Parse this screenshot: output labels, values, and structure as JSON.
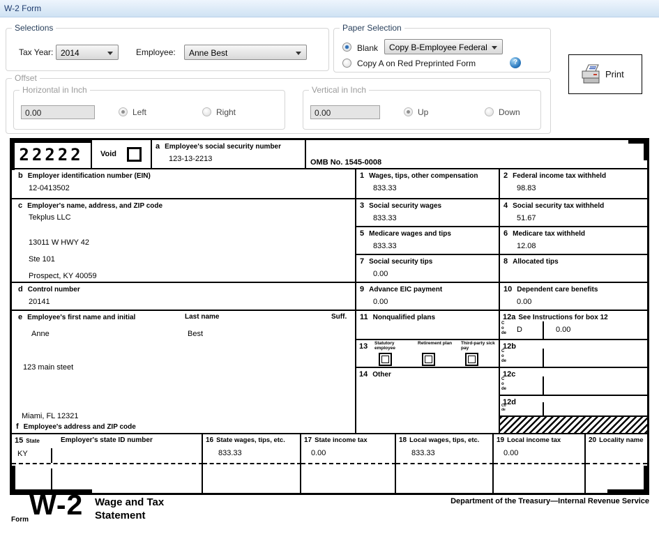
{
  "window": {
    "title": "W-2 Form"
  },
  "selections": {
    "label": "Selections",
    "tax_year": {
      "label": "Tax Year:",
      "value": "2014"
    },
    "employee": {
      "label": "Employee:",
      "value": "Anne Best"
    }
  },
  "paper_selection": {
    "label": "Paper Selection",
    "blank": "Blank",
    "copy_type": "Copy B-Employee Federal",
    "copy_a": "Copy A on Red Preprinted Form"
  },
  "print": {
    "label": "Print"
  },
  "offset": {
    "label": "Offset",
    "horizontal": {
      "label": "Horizontal in Inch",
      "value": "0.00",
      "left": "Left",
      "right": "Right"
    },
    "vertical": {
      "label": "Vertical in Inch",
      "value": "0.00",
      "up": "Up",
      "down": "Down"
    }
  },
  "form": {
    "code": "22222",
    "void": "Void",
    "omb": "OMB No. 1545-0008",
    "a": {
      "letter": "a",
      "label": "Employee's social security number",
      "value": "123-13-2213"
    },
    "b": {
      "letter": "b",
      "label": "Employer identification number (EIN)",
      "value": "12-0413502"
    },
    "c": {
      "letter": "c",
      "label": "Employer's name, address, and ZIP code",
      "line1": "Tekplus LLC",
      "line2": "13011 W HWY 42",
      "line3": "Ste 101",
      "line4": "Prospect, KY 40059"
    },
    "d": {
      "letter": "d",
      "label": "Control number",
      "value": "20141"
    },
    "e": {
      "letter": "e",
      "label": "Employee's first name and initial",
      "last_label": "Last name",
      "suff_label": "Suff.",
      "first": "Anne",
      "last": "Best",
      "street": "123 main steet",
      "city": "Miami, FL 12321"
    },
    "f": {
      "letter": "f",
      "label": "Employee's address and ZIP code"
    },
    "box1": {
      "num": "1",
      "label": "Wages, tips, other compensation",
      "value": "833.33"
    },
    "box2": {
      "num": "2",
      "label": "Federal income tax withheld",
      "value": "98.83"
    },
    "box3": {
      "num": "3",
      "label": "Social security wages",
      "value": "833.33"
    },
    "box4": {
      "num": "4",
      "label": "Social security tax withheld",
      "value": "51.67"
    },
    "box5": {
      "num": "5",
      "label": "Medicare wages and tips",
      "value": "833.33"
    },
    "box6": {
      "num": "6",
      "label": "Medicare tax withheld",
      "value": "12.08"
    },
    "box7": {
      "num": "7",
      "label": "Social security tips",
      "value": "0.00"
    },
    "box8": {
      "num": "8",
      "label": "Allocated tips",
      "value": ""
    },
    "box9": {
      "num": "9",
      "label": "Advance EIC payment",
      "value": "0.00"
    },
    "box10": {
      "num": "10",
      "label": "Dependent care benefits",
      "value": "0.00"
    },
    "box11": {
      "num": "11",
      "label": "Nonqualified plans",
      "value": ""
    },
    "box12a": {
      "num": "12a",
      "label": "See Instructions for box 12",
      "code_word": "Code",
      "code": "D",
      "value": "0.00"
    },
    "box12b": {
      "num": "12b",
      "code_word": "Code"
    },
    "box12c": {
      "num": "12c",
      "code_word": "Code"
    },
    "box12d": {
      "num": "12d",
      "code_word": "Code"
    },
    "box13": {
      "num": "13",
      "statutory": "Statutory employee",
      "retirement": "Retirement plan",
      "thirdparty": "Third-party sick pay"
    },
    "box14": {
      "num": "14",
      "label": "Other"
    },
    "box15": {
      "num": "15",
      "state_label": "State",
      "id_label": "Employer's state ID number",
      "state": "KY"
    },
    "box16": {
      "num": "16",
      "label": "State wages, tips, etc.",
      "value": "833.33"
    },
    "box17": {
      "num": "17",
      "label": "State income tax",
      "value": "0.00"
    },
    "box18": {
      "num": "18",
      "label": "Local wages, tips, etc.",
      "value": "833.33"
    },
    "box19": {
      "num": "19",
      "label": "Local income tax",
      "value": "0.00"
    },
    "box20": {
      "num": "20",
      "label": "Locality name",
      "value": ""
    },
    "footer": {
      "form_word": "Form",
      "form_number": "W-2",
      "title_line1": "Wage and Tax",
      "title_line2": "Statement",
      "dept": "Department of the Treasury—Internal Revenue Service"
    }
  }
}
